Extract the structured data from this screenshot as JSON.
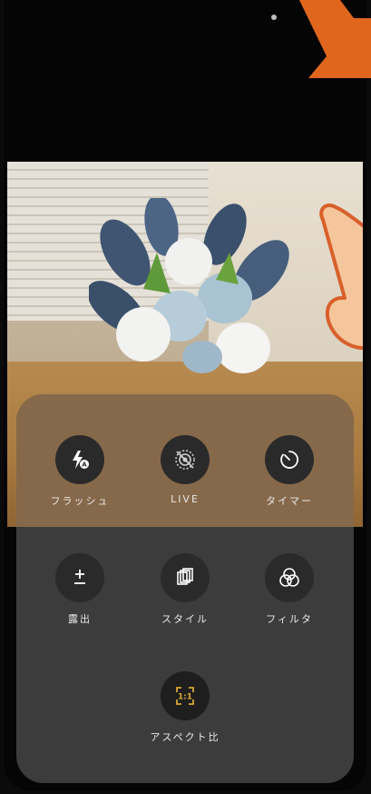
{
  "controls": {
    "row1": [
      {
        "label": "フラッシュ",
        "icon": "flash-auto-icon"
      },
      {
        "label": "LIVE",
        "icon": "live-off-icon"
      },
      {
        "label": "タイマー",
        "icon": "timer-icon"
      }
    ],
    "row2": [
      {
        "label": "露出",
        "icon": "exposure-icon"
      },
      {
        "label": "スタイル",
        "icon": "style-icon"
      },
      {
        "label": "フィルタ",
        "icon": "filter-icon"
      }
    ],
    "row3": [
      {
        "label": "アスペクト比",
        "icon": "aspect-ratio-icon",
        "value": "1:1"
      }
    ]
  },
  "colors": {
    "accent_gold": "#d8a838",
    "panel": "#3c3c3c",
    "panel_tint": "#86694a",
    "annotation_orange": "#e0661e"
  }
}
